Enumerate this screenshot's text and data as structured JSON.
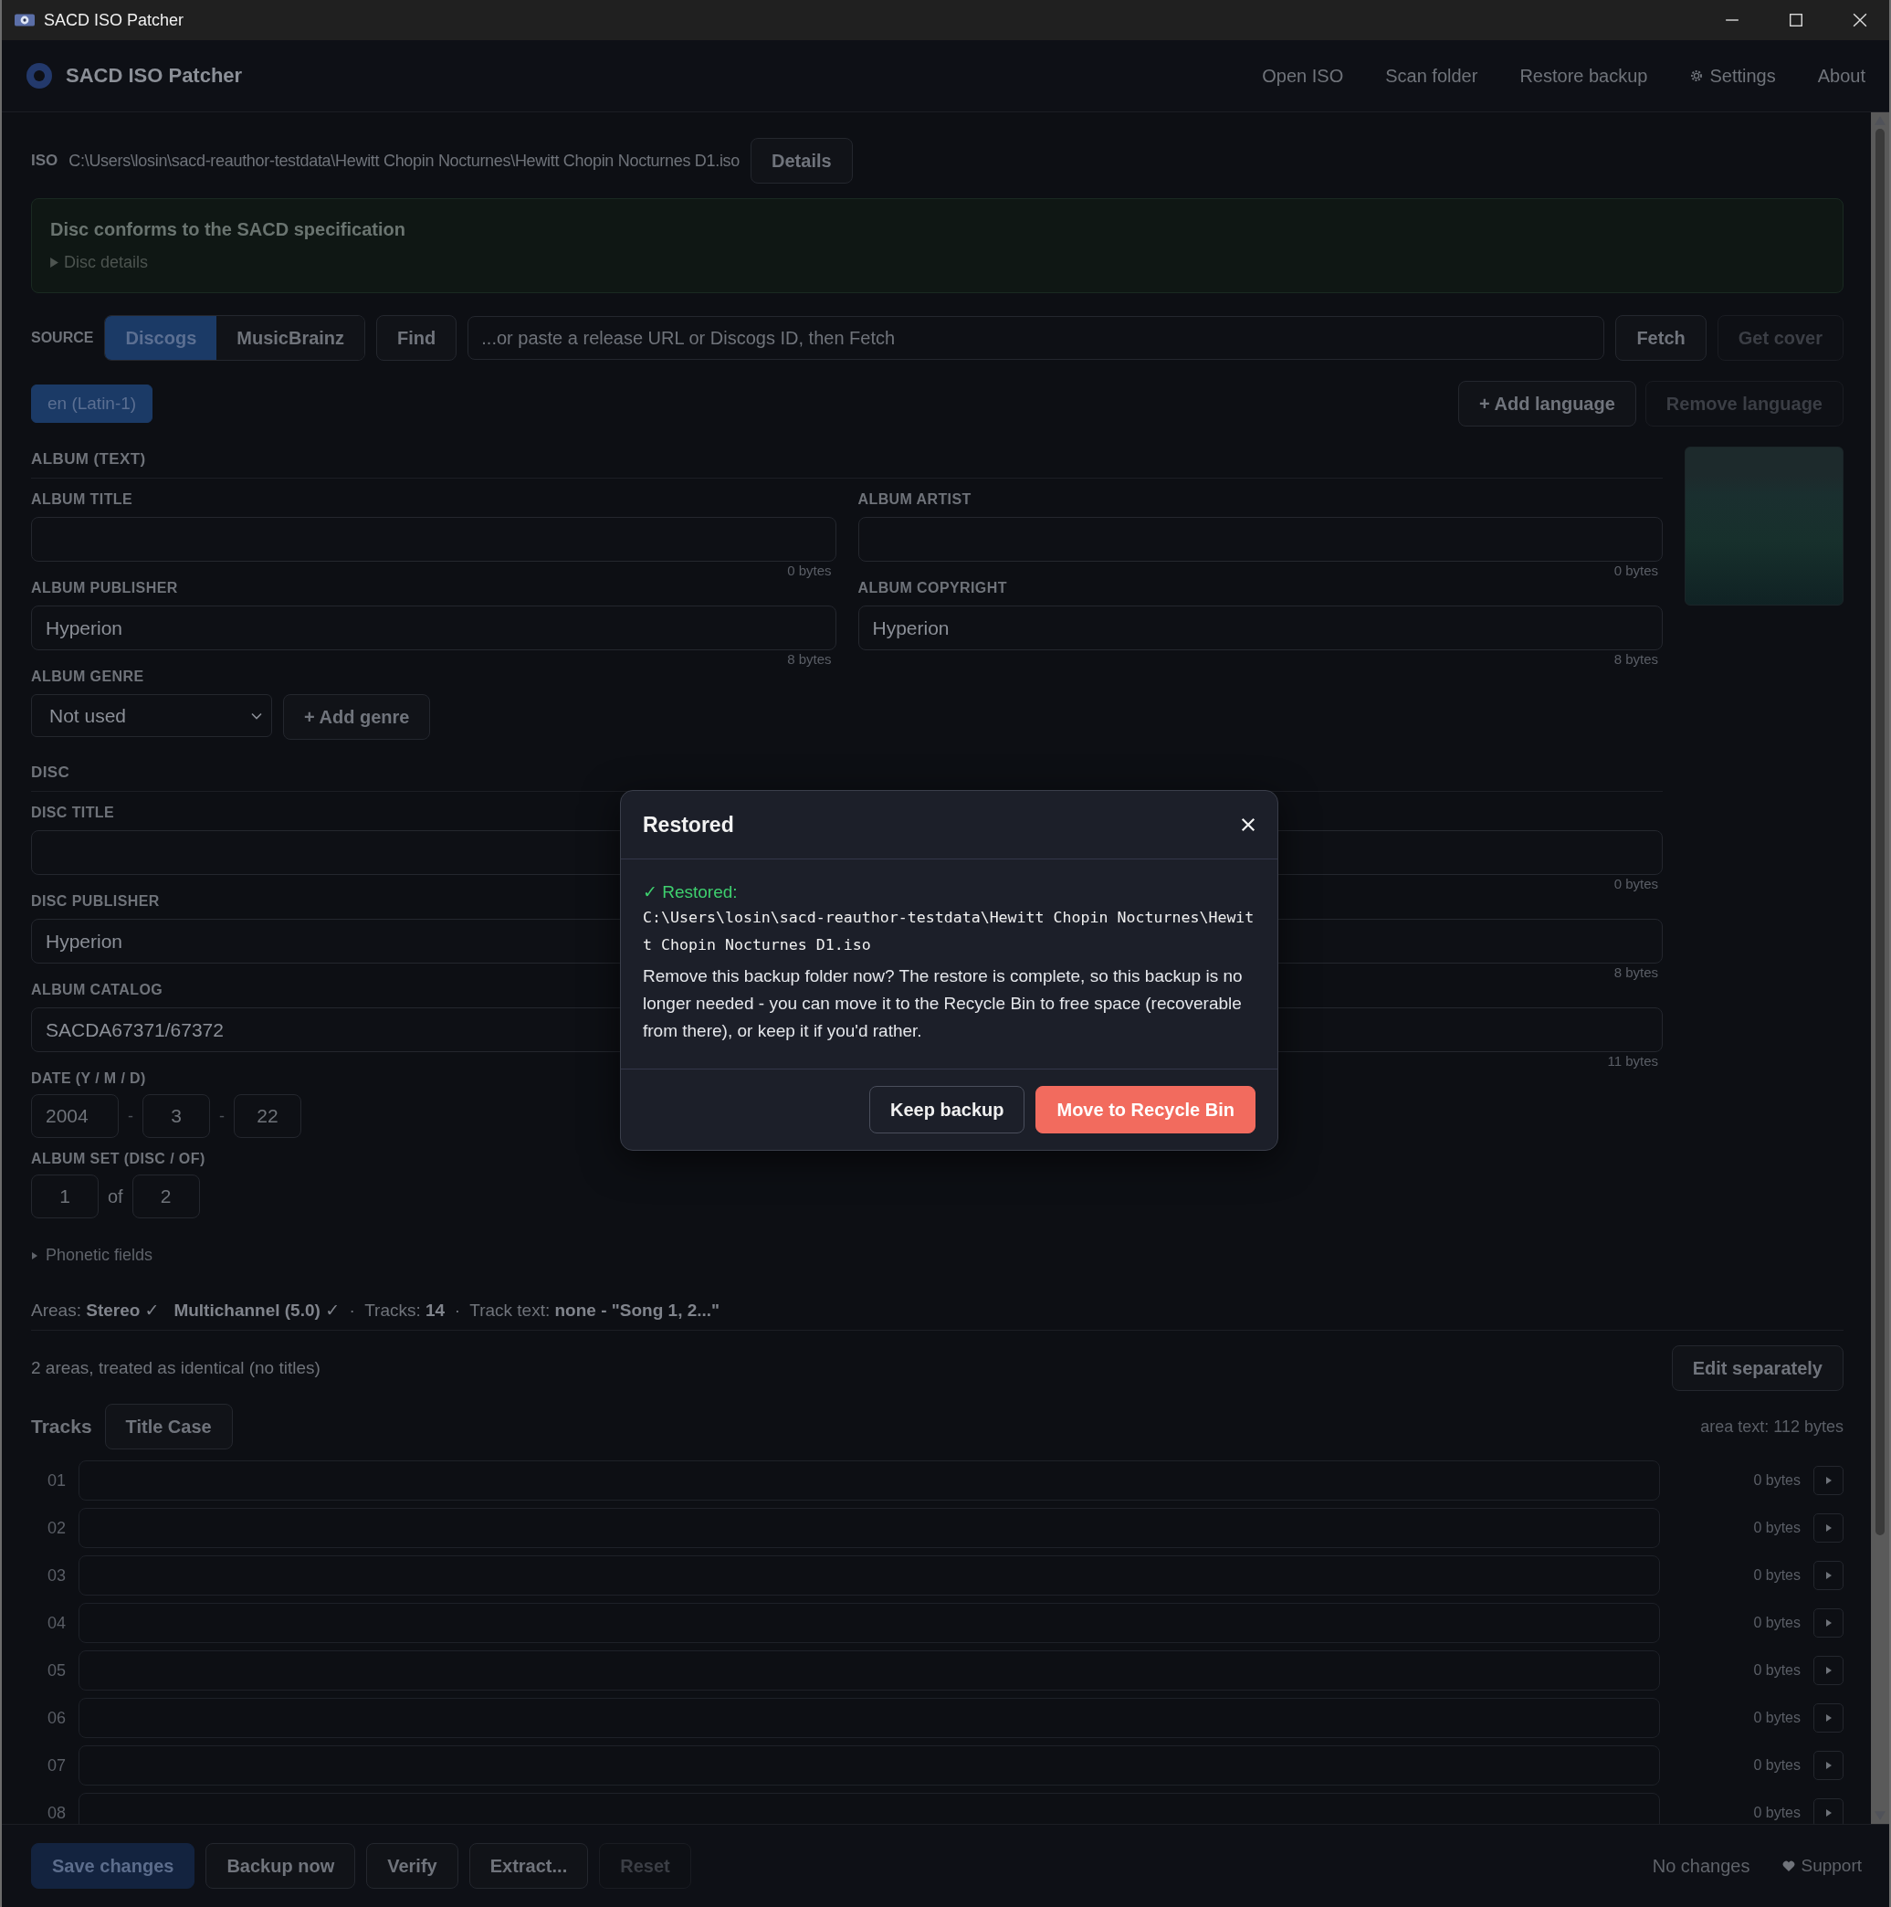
{
  "window": {
    "title": "SACD ISO Patcher"
  },
  "header": {
    "app_name": "SACD ISO Patcher",
    "nav": [
      {
        "label": "Open ISO",
        "kind": "link"
      },
      {
        "label": "Scan folder",
        "kind": "link"
      },
      {
        "label": "Restore backup",
        "kind": "link"
      },
      {
        "label": "Settings",
        "kind": "settings"
      },
      {
        "label": "About",
        "kind": "link"
      }
    ]
  },
  "iso": {
    "label": "ISO",
    "path": "C:\\Users\\losin\\sacd-reauthor-testdata\\Hewitt Chopin Nocturnes\\Hewitt Chopin Nocturnes D1.iso",
    "button": "Details"
  },
  "conformance": {
    "message": "Disc conforms to the SACD specification",
    "details": {
      "label": "Disc details",
      "expanded": false
    }
  },
  "source": {
    "label": "SOURCE",
    "tabs": [
      {
        "label": "Discogs",
        "selected": true
      },
      {
        "label": "MusicBrainz",
        "selected": false
      }
    ],
    "find": "Find",
    "url": {
      "placeholder": "...or paste a release URL or Discogs ID, then Fetch"
    },
    "buttons": [
      {
        "label": "Fetch",
        "disabled": false
      },
      {
        "label": "Get cover",
        "disabled": true
      }
    ]
  },
  "languages": {
    "items": [
      {
        "label": "en (Latin-1)",
        "selected": true
      }
    ],
    "buttons": [
      {
        "label": "+ Add language",
        "disabled": false
      },
      {
        "label": "Remove language",
        "disabled": true
      }
    ]
  },
  "album": {
    "heading": "ALBUM (TEXT)",
    "fields": [
      {
        "label": "ALBUM TITLE",
        "bytes": "0 bytes"
      },
      {
        "label": "ALBUM ARTIST",
        "bytes": "0 bytes"
      },
      {
        "label": "ALBUM PUBLISHER",
        "value": "Hyperion",
        "bytes": "8 bytes"
      },
      {
        "label": "ALBUM COPYRIGHT",
        "value": "Hyperion",
        "bytes": "8 bytes"
      }
    ],
    "genre": {
      "label": "ALBUM GENRE",
      "value": "Not used",
      "add": "+ Add genre"
    }
  },
  "disc": {
    "heading": "DISC",
    "rows": [
      {
        "left": {
          "label": "DISC TITLE"
        },
        "right": {
          "bytes": "0 bytes"
        }
      },
      {
        "left": {
          "label": "DISC PUBLISHER",
          "value": "Hyperion"
        },
        "right": {
          "bytes": "8 bytes"
        }
      },
      {
        "left": {
          "label": "ALBUM CATALOG",
          "value": "SACDA67371/67372"
        },
        "right": {
          "bytes": "11 bytes"
        }
      }
    ],
    "date": {
      "label": "DATE (Y / M / D)",
      "parts": [
        "2004",
        "3",
        "22"
      ],
      "separators": [
        "-",
        "-"
      ]
    },
    "album_set": {
      "label": "ALBUM SET (DISC / OF)",
      "disc": "1",
      "of": "of",
      "total": "2"
    },
    "phonetic": {
      "label": "Phonetic fields",
      "expanded": false
    }
  },
  "summary": "Areas: **Stereo ✓**   **Multichannel (5.0) ✓**  ·  Tracks: **14**  ·  Track text: **none - \"Song 1, 2...\"**",
  "areas": {
    "text": "2 areas, treated as identical (no titles)",
    "button": "Edit separately"
  },
  "tracks": {
    "heading": "Tracks",
    "title_case": "Title Case",
    "area_text": "area text: 112 bytes",
    "rows": [
      {
        "number": "01",
        "bytes": "0 bytes"
      },
      {
        "number": "02",
        "bytes": "0 bytes"
      },
      {
        "number": "03",
        "bytes": "0 bytes"
      },
      {
        "number": "04",
        "bytes": "0 bytes"
      },
      {
        "number": "05",
        "bytes": "0 bytes"
      },
      {
        "number": "06",
        "bytes": "0 bytes"
      },
      {
        "number": "07",
        "bytes": "0 bytes"
      },
      {
        "number": "08",
        "bytes": "0 bytes"
      }
    ]
  },
  "footer": {
    "buttons": [
      {
        "label": "Save changes",
        "kind": "primary",
        "disabled": true
      },
      {
        "label": "Backup now",
        "kind": "secondary",
        "disabled": false
      },
      {
        "label": "Verify",
        "kind": "secondary",
        "disabled": false
      },
      {
        "label": "Extract...",
        "kind": "secondary",
        "disabled": false
      },
      {
        "label": "Reset",
        "kind": "secondary",
        "disabled": true
      }
    ],
    "status": "No changes",
    "support": "Support"
  },
  "dialog": {
    "title": "Restored",
    "status": "✓ Restored:",
    "path": "C:\\Users\\losin\\sacd-reauthor-testdata\\Hewitt Chopin Nocturnes\\Hewitt Chopin Nocturnes D1.iso",
    "message": "Remove this backup folder now? The restore is complete, so this backup is no longer needed - you can move it to the Recycle Bin to free space (recoverable from there), or keep it if you'd rather.",
    "buttons": [
      {
        "label": "Keep backup",
        "kind": "secondary"
      },
      {
        "label": "Move to Recycle Bin",
        "kind": "danger"
      }
    ]
  }
}
